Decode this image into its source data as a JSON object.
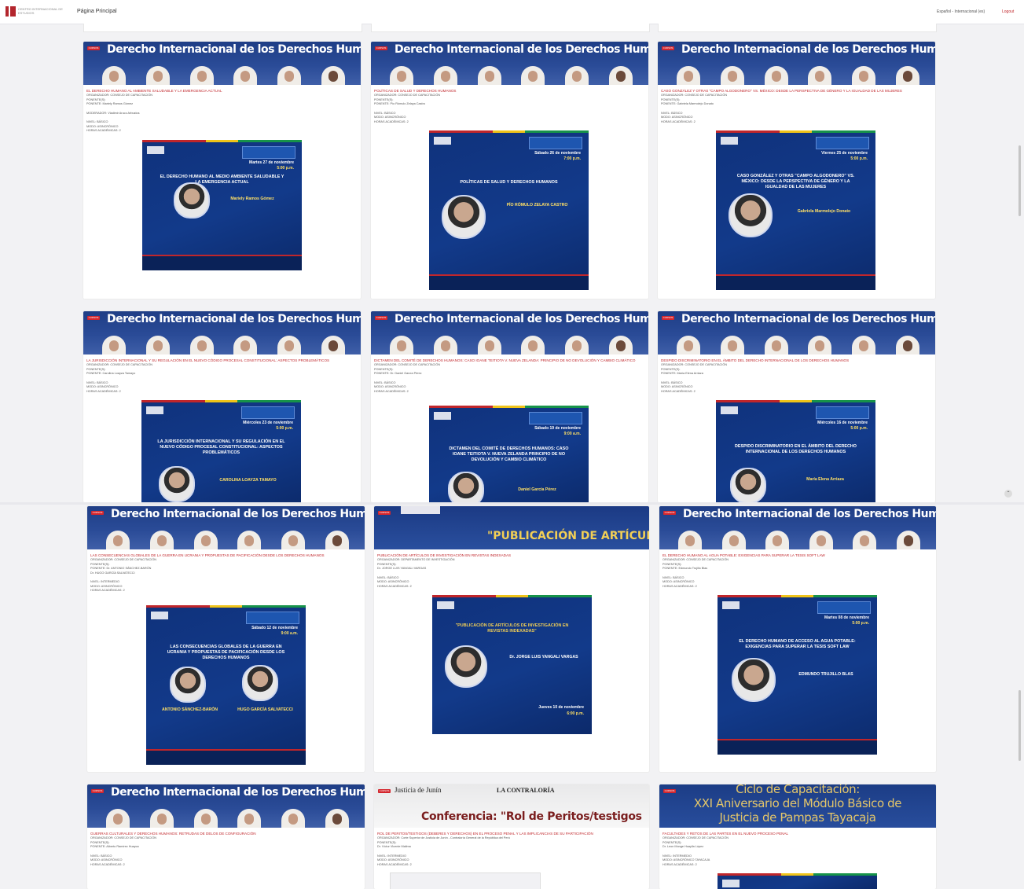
{
  "header": {
    "logo_text": "CENTRO INTERNACIONAL DE ESTUDIOS",
    "home_label": "Página Principal",
    "language": "Español - Internacional (es)",
    "logout": "Logout"
  },
  "banner_title": "Derecho Internacional de los Derechos Humanos",
  "badge_label": "CURSOS",
  "cards": [
    {
      "event_title": "EL DERECHO HUMANO AL AMBIENTE SALUDABLE Y LA EMERGENCIA ACTUAL",
      "organizer": "ORGANIZADOR: CONSEJO DE CAPACITACIÓN",
      "speaker_label": "PONENTE(S):",
      "speaker": "PONENTE: Mariely Ramos Gómez",
      "moderator": "MODERADOR: Vladimir Aruco Arbustos",
      "level": "NIVEL: BÁSICO",
      "mode": "MODO: ASINCRÓNICO",
      "hours": "HORAS ACADÉMICAS: 2",
      "poster_date": "Martes 27 de noviembre",
      "poster_time": "5:00 p.m.",
      "poster_title": "EL DERECHO HUMANO AL MEDIO AMBIENTE SALUDABLE Y LA EMERGENCIA ACTUAL",
      "poster_speaker": "Mariely Ramos Gómez"
    },
    {
      "event_title": "POLÍTICAS DE SALUD Y DERECHOS HUMANOS",
      "organizer": "ORGANIZADOR: CONSEJO DE CAPACITACIÓN",
      "speaker_label": "PONENTE(S):",
      "speaker": "PONENTE: Pío Rómulo Zelaya Castro",
      "moderator": "",
      "level": "NIVEL: BÁSICO",
      "mode": "MODO: ASINCRÓNICO",
      "hours": "HORAS ACADÉMICAS: 2",
      "poster_date": "Sábado 26 de noviembre",
      "poster_time": "7:00 p.m.",
      "poster_title": "POLÍTICAS DE SALUD Y DERECHOS HUMANOS",
      "poster_speaker": "PÍO RÓMULO ZELAYA CASTRO"
    },
    {
      "event_title": "CASO GONZÁLEZ Y OTRAS \"CAMPO ALGODONERO\" VS. MÉXICO: DESDE LA PERSPECTIVA DE GÉNERO Y LA IGUALDAD DE LAS MUJERES",
      "organizer": "ORGANIZADOR: CONSEJO DE CAPACITACIÓN",
      "speaker_label": "PONENTE(S):",
      "speaker": "PONENTE: Gabriela Marmolejo Donato",
      "moderator": "",
      "level": "NIVEL: BÁSICO",
      "mode": "MODO: ASINCRÓNICO",
      "hours": "HORAS ACADÉMICAS: 2",
      "poster_date": "Viernes 25 de noviembre",
      "poster_time": "5:00 p.m.",
      "poster_title": "CASO GONZÁLEZ Y OTRAS \"CAMPO ALGODONERO\" VS. MÉXICO: DESDE LA PERSPECTIVA DE GÉNERO Y LA IGUALDAD DE LAS MUJERES",
      "poster_speaker": "Gabriela Marmolejo Donato"
    },
    {
      "event_title": "LA JURISDICCIÓN INTERNACIONAL Y SU REGULACIÓN EN EL NUEVO CÓDIGO PROCESAL CONSTITUCIONAL: ASPECTOS PROBLEMÁTICOS",
      "organizer": "ORGANIZADOR: CONSEJO DE CAPACITACIÓN",
      "speaker_label": "PONENTE(S):",
      "speaker": "PONENTE: Carolina Loayza Tamayo",
      "moderator": "",
      "level": "NIVEL: BÁSICO",
      "mode": "MODO: ASINCRÓNICO",
      "hours": "HORAS ACADÉMICAS: 2",
      "poster_date": "Miércoles 23 de noviembre",
      "poster_time": "5:00 p.m.",
      "poster_title": "LA JURISDICCIÓN INTERNACIONAL Y SU REGULACIÓN EN EL NUEVO CÓDIGO PROCESAL CONSTITUCIONAL: ASPECTOS PROBLEMÁTICOS",
      "poster_speaker": "CAROLINA LOAYZA TAMAYO"
    },
    {
      "event_title": "DICTAMEN DEL COMITÉ DE DERECHOS HUMANOS: CASO IOANE TEITIOTA V. NUEVA ZELANDA: PRINCIPIO DE NO DEVOLUCIÓN Y CAMBIO CLIMÁTICO",
      "organizer": "ORGANIZADOR: CONSEJO DE CAPACITACIÓN",
      "speaker_label": "PONENTE(S):",
      "speaker": "PONENTE: Dr. Daniel García Pérez",
      "moderator": "",
      "level": "NIVEL: BÁSICO",
      "mode": "MODO: ASINCRÓNICO",
      "hours": "HORAS ACADÉMICAS: 2",
      "poster_date": "Sábado 19 de noviembre",
      "poster_time": "9:00 a.m.",
      "poster_title": "DICTAMEN DEL COMITÉ DE DERECHOS HUMANOS: CASO IOANE TEITIOTA V. NUEVA ZELANDA PRINCIPIO DE NO DEVOLUCIÓN Y CAMBIO CLIMÁTICO",
      "poster_speaker": "Daniel García Pérez"
    },
    {
      "event_title": "DESPIDO DISCRIMINATORIO EN EL ÁMBITO DEL DERECHO INTERNACIONAL DE LOS DERECHOS HUMANOS",
      "organizer": "ORGANIZADOR: CONSEJO DE CAPACITACIÓN",
      "speaker_label": "PONENTE(S):",
      "speaker": "PONENTE: María Elena Arriaza",
      "moderator": "",
      "level": "NIVEL: BÁSICO",
      "mode": "MODO: ASINCRÓNICO",
      "hours": "HORAS ACADÉMICAS: 2",
      "poster_date": "Miércoles 16 de noviembre",
      "poster_time": "5:00 p.m.",
      "poster_title": "DESPIDO DISCRIMINATORIO EN EL ÁMBITO DEL DERECHO INTERNACIONAL DE LOS DERECHOS HUMANOS",
      "poster_speaker": "María Elena Arriaza"
    },
    {
      "event_title": "LAS CONSECUENCIAS GLOBALES DE LA GUERRA EN UCRANIA Y PROPUESTAS DE PACIFICACIÓN DESDE LOS DERECHOS HUMANOS",
      "organizer": "ORGANIZADOR: CONSEJO DE CAPACITACIÓN",
      "speaker_label": "PONENTE(S):",
      "speaker": "PONENTE: Dr. ANTONIO SÁNCHEZ-BARÓN",
      "moderator": "Dr. HUGO GARCÍA SALVATECCI",
      "level": "NIVEL: INTERMEDIO",
      "mode": "MODO: ASINCRÓNICO",
      "hours": "HORAS ACADÉMICAS: 2",
      "poster_date": "Sábado 12 de noviembre",
      "poster_time": "9:00 a.m.",
      "poster_title": "LAS CONSECUENCIAS GLOBALES DE LA GUERRA EN UCRANIA Y PROPUESTAS DE PACIFICACIÓN DESDE LOS DERECHOS HUMANOS",
      "poster_speaker": "ANTONIO SÁNCHEZ-BARÓN",
      "poster_speaker2": "HUGO GARCÍA SALVATECCI"
    },
    {
      "event_title": "PUBLICACIÓN DE ARTÍCULOS DE INVESTIGACIÓN EN REVISTAS INDEXADAS",
      "organizer": "ORGANIZADOR: DEPARTAMENTO DE INVESTIGACIÓN",
      "speaker_label": "PONENTE(S):",
      "speaker": "Dr. JORGE LUIS YANGALI VARGAS",
      "moderator": "",
      "level": "NIVEL: BÁSICO",
      "mode": "MODO: ASINCRÓNICO",
      "hours": "HORAS ACADÉMICAS: 2",
      "poster_date": "Jueves 10 de noviembre",
      "poster_time": "6:00 p.m.",
      "poster_title": "\"PUBLICACIÓN DE ARTÍCULOS DE INVESTIGACIÓN EN REVISTAS INDEXADAS\"",
      "poster_speaker": "Dr. JORGE LUIS YANGALI VARGAS",
      "banner_text": "\"PUBLICACIÓN DE ARTÍCULOS DE"
    },
    {
      "event_title": "EL DERECHO HUMANO AL AGUA POTABLE: EXIGENCIAS PARA SUPERAR LA TESIS SOFT LAW",
      "organizer": "ORGANIZADOR: CONSEJO DE CAPACITACIÓN",
      "speaker_label": "PONENTE(S):",
      "speaker": "PONENTE: Edmundo Trujillo Blas",
      "moderator": "",
      "level": "NIVEL: BÁSICO",
      "mode": "MODO: ASINCRÓNICO",
      "hours": "HORAS ACADÉMICAS: 2",
      "poster_date": "Martes 08 de noviembre",
      "poster_time": "5:00 p.m.",
      "poster_title": "EL DERECHO HUMANO DE ACCESO AL AGUA POTABLE: EXIGENCIAS PARA SUPERAR LA TESIS SOFT LAW",
      "poster_speaker": "EDMUNDO TRUJILLO BLAS"
    },
    {
      "event_title": "GUERRAS CULTURALES Y DERECHOS HUMANOS: RETRUDAS DE DELOS DE CONFIGURACIÓN",
      "organizer": "ORGANIZADOR: CONSEJO DE CAPACITACIÓN",
      "speaker_label": "PONENTE(S):",
      "speaker": "PONENTE: Alberto Ramírez Huayca",
      "moderator": "",
      "level": "NIVEL: BÁSICO",
      "mode": "MODO: ASINCRÓNICO",
      "hours": "HORAS ACADÉMICAS: 2"
    },
    {
      "event_title": "ROL DE PERITOS/TESTIGOS (DEBERES Y DERECHOS) EN EL PROCESO PENAL Y LAS IMPLICANCIAS DE SU PARTICIPACIÓN",
      "organizer": "ORGANIZADOR: Corte Superior de Justicia de Junín - Contraloría General de la República del Perú",
      "speaker_label": "PONENTE(S):",
      "speaker": "Dr. Víctor Vicente Mallma",
      "moderator": "",
      "level": "NIVEL: INTERMEDIO",
      "mode": "MODO: ASINCRÓNICO",
      "hours": "HORAS ACADÉMICAS: 2",
      "banner_text": "Conferencia: \"Rol de Peritos/testigos",
      "banner_small": "Justicia de Junín",
      "banner_small2": "LA CONTRALORÍA"
    },
    {
      "event_title": "FACULTADES Y RETOS DE LAS PARTES EN EL NUEVO PROCESO PENAL",
      "organizer": "ORGANIZADOR: CONSEJO DE CAPACITACIÓN",
      "speaker_label": "PONENTE(S):",
      "speaker": "Dr. Leon Monge Huaylla López",
      "moderator": "",
      "level": "NIVEL: INTERMEDIO",
      "mode": "MODO: ASINCRÓNICO TAYACAJA",
      "hours": "HORAS ACADÉMICAS: 2",
      "banner_line1": "Ciclo de Capacitación:",
      "banner_line2": "XXI Aniversario del Módulo Básico de",
      "banner_line3": "Justicia de Pampas Tayacaja"
    }
  ]
}
